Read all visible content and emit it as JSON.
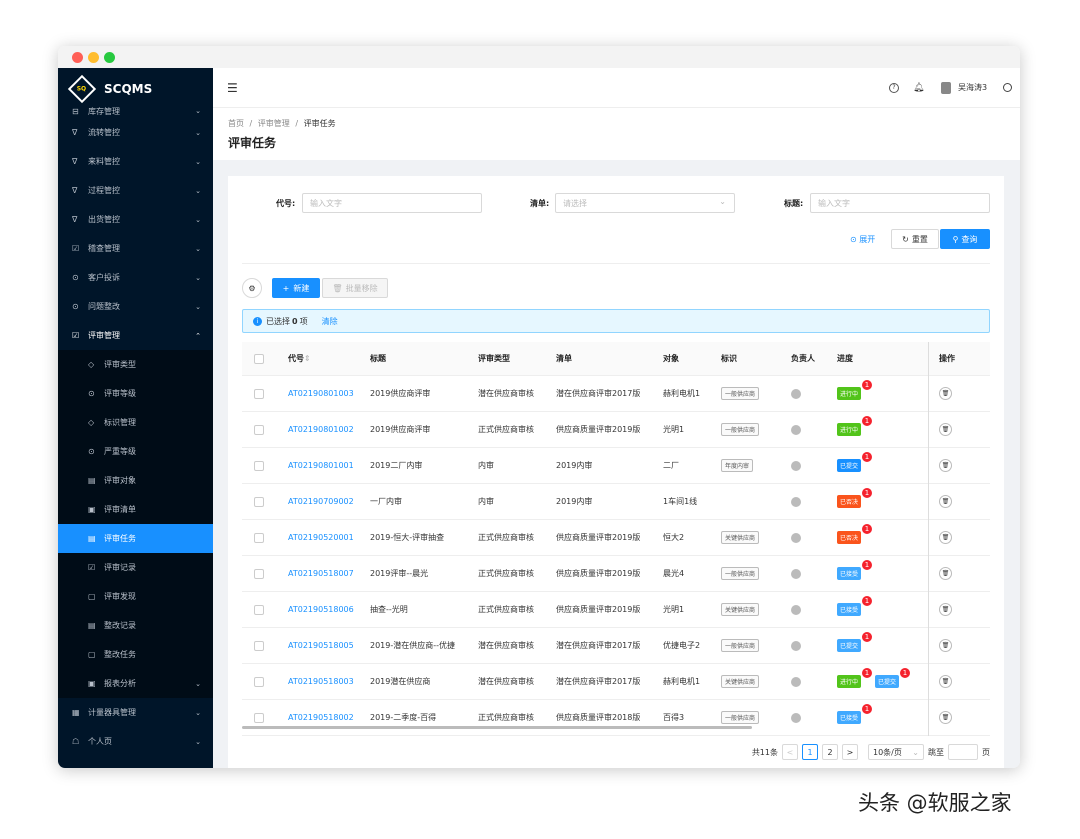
{
  "app": {
    "name": "SCQMS",
    "logo_text": "SQ"
  },
  "sidebar": {
    "items": [
      {
        "icon": "⊟",
        "label": "库存管理"
      },
      {
        "icon": "∇",
        "label": "流转管控"
      },
      {
        "icon": "∇",
        "label": "来料管控"
      },
      {
        "icon": "∇",
        "label": "过程管控"
      },
      {
        "icon": "∇",
        "label": "出货管控"
      },
      {
        "icon": "☑",
        "label": "稽查管理"
      },
      {
        "icon": "⊙",
        "label": "客户投诉"
      },
      {
        "icon": "⊙",
        "label": "问题整改"
      },
      {
        "icon": "☑",
        "label": "评审管理"
      }
    ],
    "sub_items": [
      {
        "icon": "◇",
        "label": "评审类型"
      },
      {
        "icon": "⊙",
        "label": "评审等级"
      },
      {
        "icon": "◇",
        "label": "标识管理"
      },
      {
        "icon": "⊙",
        "label": "严重等级"
      },
      {
        "icon": "▤",
        "label": "评审对象"
      },
      {
        "icon": "▣",
        "label": "评审清单"
      },
      {
        "icon": "▤",
        "label": "评审任务"
      },
      {
        "icon": "☑",
        "label": "评审记录"
      },
      {
        "icon": "▢",
        "label": "评审发现"
      },
      {
        "icon": "▤",
        "label": "整改记录"
      },
      {
        "icon": "▢",
        "label": "整改任务"
      },
      {
        "icon": "▣",
        "label": "报表分析"
      }
    ],
    "bottom_items": [
      {
        "icon": "▦",
        "label": "计量器具管理"
      },
      {
        "icon": "☖",
        "label": "个人页"
      }
    ]
  },
  "header": {
    "user_name": "吴海涛3"
  },
  "breadcrumb": {
    "home": "首页",
    "sep": "/",
    "section": "评审管理",
    "current": "评审任务"
  },
  "page_title": "评审任务",
  "filters": {
    "code_label": "代号:",
    "code_placeholder": "输入文字",
    "list_label": "清单:",
    "list_placeholder": "请选择",
    "title_label": "标题:",
    "title_placeholder": "输入文字",
    "expand": "展开",
    "reset": "重置",
    "query": "查询"
  },
  "toolbar": {
    "new": "新建",
    "batch_remove": "批量移除"
  },
  "selection": {
    "prefix": "已选择",
    "count": "0",
    "suffix": "项",
    "clear": "清除"
  },
  "table": {
    "headers": [
      "代号",
      "标题",
      "评审类型",
      "清单",
      "对象",
      "标识",
      "负责人",
      "进度",
      "操作"
    ],
    "rows": [
      {
        "code": "AT02190801003",
        "title": "2019供应商评审",
        "type": "潜在供应商审核",
        "list": "潜在供应商评审2017版",
        "object": "赫利电机1",
        "tag": "一般供应商",
        "progress": "进行中",
        "pcolor": "#52c41a",
        "badge": "1"
      },
      {
        "code": "AT02190801002",
        "title": "2019供应商评审",
        "type": "正式供应商审核",
        "list": "供应商质量评审2019版",
        "object": "光明1",
        "tag": "一般供应商",
        "progress": "进行中",
        "pcolor": "#52c41a",
        "badge": "1"
      },
      {
        "code": "AT02190801001",
        "title": "2019二厂内审",
        "type": "内审",
        "list": "2019内审",
        "object": "二厂",
        "tag": "年度内审",
        "progress": "已提交",
        "pcolor": "#1890ff",
        "badge": "1"
      },
      {
        "code": "AT02190709002",
        "title": "一厂内审",
        "type": "内审",
        "list": "2019内审",
        "object": "1车间1线",
        "tag": "",
        "progress": "已否决",
        "pcolor": "#fa541c",
        "badge": "1"
      },
      {
        "code": "AT02190520001",
        "title": "2019-恒大-评审抽查",
        "type": "正式供应商审核",
        "list": "供应商质量评审2019版",
        "object": "恒大2",
        "tag": "关键供应商",
        "progress": "已否决",
        "pcolor": "#fa541c",
        "badge": "1"
      },
      {
        "code": "AT02190518007",
        "title": "2019评审--晨光",
        "type": "正式供应商审核",
        "list": "供应商质量评审2019版",
        "object": "晨光4",
        "tag": "一般供应商",
        "progress": "已接受",
        "pcolor": "#40a9ff",
        "badge": "1"
      },
      {
        "code": "AT02190518006",
        "title": "抽查--光明",
        "type": "正式供应商审核",
        "list": "供应商质量评审2019版",
        "object": "光明1",
        "tag": "关键供应商",
        "progress": "已接受",
        "pcolor": "#40a9ff",
        "badge": "1"
      },
      {
        "code": "AT02190518005",
        "title": "2019-潜在供应商--优捷",
        "type": "潜在供应商审核",
        "list": "潜在供应商评审2017版",
        "object": "优捷电子2",
        "tag": "一般供应商",
        "progress": "已提交",
        "pcolor": "#40a9ff",
        "badge": "1"
      },
      {
        "code": "AT02190518003",
        "title": "2019潜在供应商",
        "type": "潜在供应商审核",
        "list": "潜在供应商评审2017版",
        "object": "赫利电机1",
        "tag": "关键供应商",
        "progress": "进行中",
        "pcolor": "#52c41a",
        "badge": "1",
        "progress2": "已提交",
        "pcolor2": "#40a9ff",
        "badge2": "1"
      },
      {
        "code": "AT02190518002",
        "title": "2019-二季度-百得",
        "type": "正式供应商审核",
        "list": "供应商质量评审2018版",
        "object": "百得3",
        "tag": "一般供应商",
        "progress": "已接受",
        "pcolor": "#40a9ff",
        "badge": "1"
      }
    ]
  },
  "pagination": {
    "total": "共11条",
    "page1": "1",
    "page2": "2",
    "page_size": "10条/页",
    "goto": "跳至",
    "page_suffix": "页"
  },
  "watermark": "头条 @软服之家"
}
